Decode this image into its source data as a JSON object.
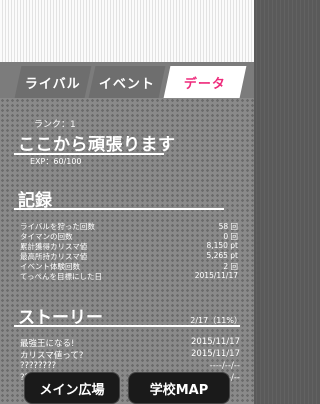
{
  "tabs": [
    "ライバル",
    "イベント",
    "データ"
  ],
  "rank_label": "ランク：1",
  "motto": "ここから頑張ります",
  "exp": "EXP：60/100",
  "record_heading": "記録",
  "records": [
    {
      "label": "ライバルを狩った回数",
      "value": "58 回"
    },
    {
      "label": "タイマンの回数",
      "value": "0 回"
    },
    {
      "label": "累計獲得カリスマ値",
      "value": "8,150 pt"
    },
    {
      "label": "最高所持カリスマ値",
      "value": "5,265 pt"
    },
    {
      "label": "イベント体験回数",
      "value": "2 回"
    },
    {
      "label": "てっぺんを目標にした日",
      "value": "2015/11/17"
    }
  ],
  "story_heading": "ストーリー",
  "story_progress": "2/17（11%）",
  "stories": [
    {
      "label": "最強王になる!",
      "value": "2015/11/17"
    },
    {
      "label": "カリスマ値って?",
      "value": "2015/11/17"
    },
    {
      "label": "????????",
      "value": "----/--/--"
    },
    {
      "label": "????????",
      "value": "----/--/--"
    }
  ],
  "buttons": [
    "メイン広場",
    "学校MAP"
  ]
}
